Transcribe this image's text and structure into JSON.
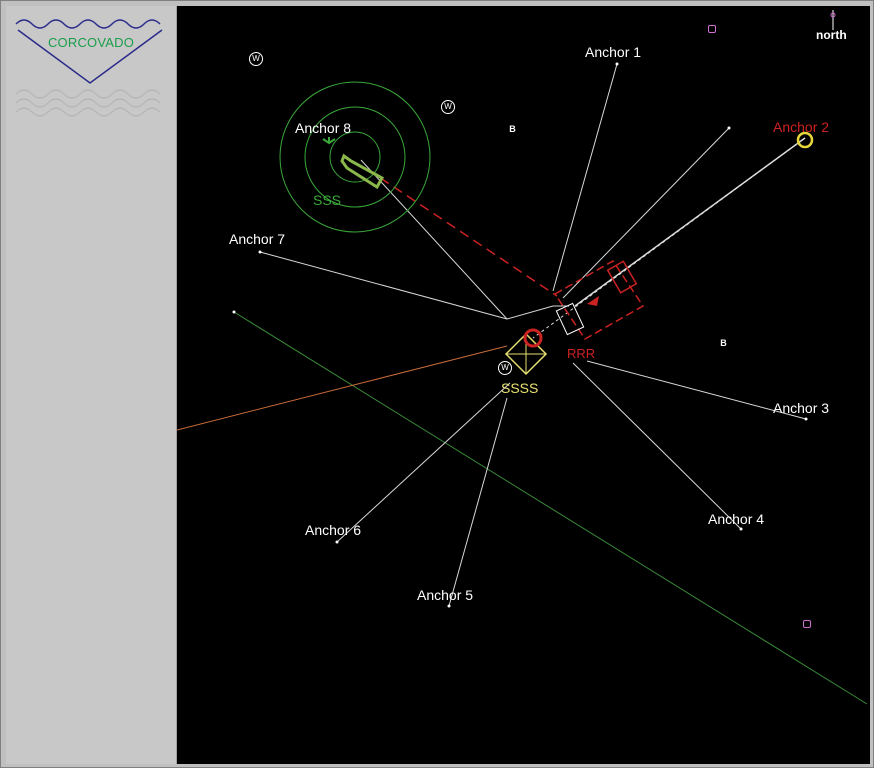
{
  "logo": {
    "text": "CORCOVADO"
  },
  "compass": {
    "label": "north"
  },
  "anchors": [
    {
      "label": "Anchor 1"
    },
    {
      "label": "Anchor 2"
    },
    {
      "label": "Anchor 3"
    },
    {
      "label": "Anchor 4"
    },
    {
      "label": "Anchor 5"
    },
    {
      "label": "Anchor 6"
    },
    {
      "label": "Anchor 7"
    },
    {
      "label": "Anchor 8"
    }
  ],
  "vessels": {
    "green": "SSS",
    "yellow": "SSSS",
    "red": "RRR"
  },
  "markers": {
    "b": "B",
    "w": "W"
  },
  "colors": {
    "background": "#000000",
    "anchor_line": "#d8d8d8",
    "red_vessel": "#cc2222",
    "green_vessel": "#3aa83a",
    "yellow_vessel": "#e8e070",
    "logo": "#2a2a8a"
  }
}
